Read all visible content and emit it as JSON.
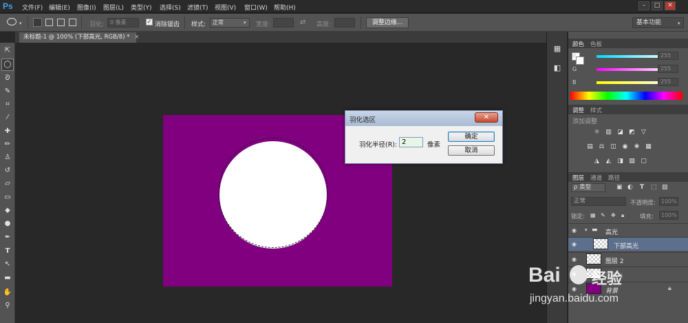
{
  "app": {
    "logo": "Ps",
    "menus": [
      "文件(F)",
      "编辑(E)",
      "图像(I)",
      "图层(L)",
      "类型(Y)",
      "选择(S)",
      "滤镜(T)",
      "视图(V)",
      "窗口(W)",
      "帮助(H)"
    ],
    "window_buttons": [
      "–",
      "□",
      "✕"
    ]
  },
  "options_bar": {
    "feather_label": "羽化:",
    "feather_value": "0 像素",
    "antialias_label": "消除锯齿",
    "style_label": "样式:",
    "style_value": "正常",
    "width_label": "宽度:",
    "height_label": "高度:",
    "refine_edge_button": "调整边缘...",
    "workspace_value": "基本功能"
  },
  "document": {
    "tab_title": "未标题-1 @ 100% (下部高光, RGB/8) *",
    "tab_close": "×",
    "background_color": "#800080"
  },
  "feather_dialog": {
    "title": "羽化选区",
    "close_symbol": "✕",
    "radius_label": "羽化半径(R):",
    "radius_value": "2",
    "unit": "像素",
    "ok_button": "确定",
    "cancel_button": "取消"
  },
  "color_panel": {
    "tabs": [
      "颜色",
      "色板"
    ],
    "channels": [
      {
        "label": "R",
        "value": "255",
        "color": "#00d8ff"
      },
      {
        "label": "G",
        "value": "255",
        "color": "#ff00ff"
      },
      {
        "label": "B",
        "value": "255",
        "color": "#ffff00"
      }
    ]
  },
  "adjustments_panel": {
    "tabs": [
      "调整",
      "样式"
    ],
    "add_label": "添加调整"
  },
  "layers_panel": {
    "tabs": [
      "图层",
      "通道",
      "路径"
    ],
    "filter_kind": "ρ 类型",
    "blend_mode": "正常",
    "opacity_label": "不透明度:",
    "opacity_value": "100%",
    "lock_label": "锁定:",
    "fill_label": "填充:",
    "fill_value": "100%",
    "layers": [
      {
        "name": "高光",
        "type": "group"
      },
      {
        "name": "下部高光",
        "type": "layer",
        "selected": true
      },
      {
        "name": "图层 2",
        "type": "layer"
      },
      {
        "name": "图层 1",
        "type": "layer"
      },
      {
        "name": "背景",
        "type": "background"
      }
    ]
  },
  "watermark": {
    "brand": "Bai",
    "brand_suffix": "经验",
    "url": "jingyan.baidu.com"
  }
}
